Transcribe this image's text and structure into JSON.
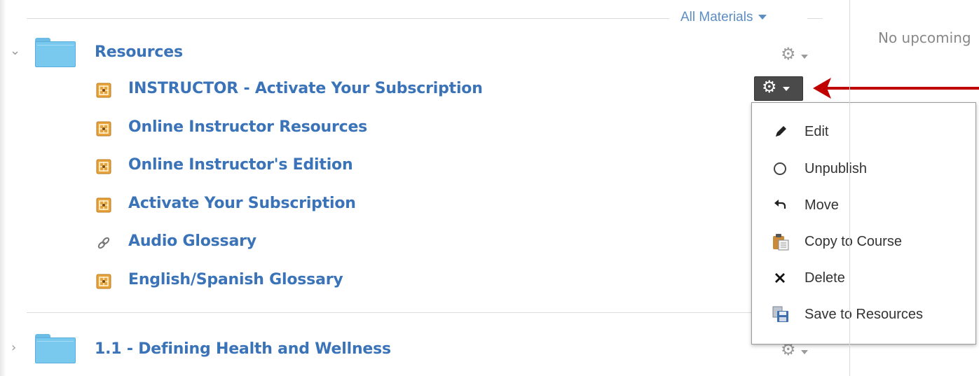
{
  "filter": {
    "label": "All Materials"
  },
  "right_panel": {
    "text": "No upcoming"
  },
  "modules": [
    {
      "title": "Resources",
      "expanded": true,
      "items": [
        {
          "title": "INSTRUCTOR - Activate Your Subscription",
          "icon": "external-tool-icon"
        },
        {
          "title": "Online Instructor Resources",
          "icon": "external-tool-icon"
        },
        {
          "title": "Online Instructor's Edition",
          "icon": "external-tool-icon"
        },
        {
          "title": "Activate Your Subscription",
          "icon": "external-tool-icon"
        },
        {
          "title": "Audio Glossary",
          "icon": "link-icon"
        },
        {
          "title": "English/Spanish Glossary",
          "icon": "external-tool-icon"
        }
      ]
    },
    {
      "title": "1.1 - Defining Health and Wellness",
      "expanded": false,
      "items": []
    }
  ],
  "settings_menu": {
    "items": [
      {
        "label": "Edit",
        "icon": "pencil-icon"
      },
      {
        "label": "Unpublish",
        "icon": "circle-icon"
      },
      {
        "label": "Move",
        "icon": "move-arrow-icon"
      },
      {
        "label": "Copy to Course",
        "icon": "clipboard-icon"
      },
      {
        "label": "Delete",
        "icon": "x-icon"
      },
      {
        "label": "Save to Resources",
        "icon": "save-icon"
      }
    ]
  },
  "colors": {
    "link": "#3b73b9",
    "folder": "#79c8ee",
    "tool_icon": "#e8a33a",
    "annotation_arrow": "#c00000",
    "active_gear_bg": "#4a4a4a"
  }
}
